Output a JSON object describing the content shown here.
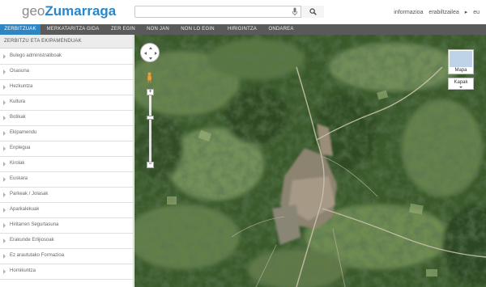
{
  "header": {
    "logo_prefix": "geo",
    "logo_city": "Zumarraga",
    "search_placeholder": "",
    "links": [
      "informazioa",
      "erabiltzailea",
      "eu"
    ]
  },
  "nav": {
    "items": [
      "ZERBITZUAK",
      "MERKATARITZA GIDA",
      "ZER EGIN",
      "NON JAN",
      "NON LO EGIN",
      "HIRIGINTZA",
      "ONDAREA"
    ],
    "active_index": 0
  },
  "sidebar": {
    "title": "ZERBITZU ETA EKIPAMENDUAK",
    "items": [
      "Bulego administratiboak",
      "Osasuna",
      "Hezkuntza",
      "Kultura",
      "Botikak",
      "Ekipamendu",
      "Enplegua",
      "Kirolak",
      "Euskara",
      "Parkeak / Jolasak",
      "Aparkalekuak",
      "Hiritarren Segurtasuna",
      "Erakunde Erlijiosoak",
      "Ez araututako Formazioa",
      "Hornikuntza"
    ]
  },
  "map": {
    "type_button": "Mapa",
    "layers_button": "Kapak",
    "zoom_in": "+",
    "zoom_out": "−"
  },
  "colors": {
    "nav_bg": "#5a5a5a",
    "nav_active": "#2e85c4",
    "brand_blue": "#2a86c8"
  }
}
